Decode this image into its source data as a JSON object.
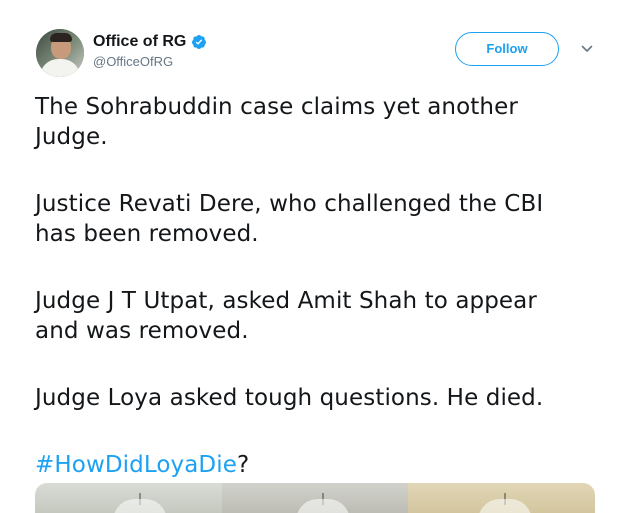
{
  "author": {
    "display_name": "Office of RG",
    "handle": "@OfficeOfRG",
    "verified": true,
    "avatar_icon": "profile-photo"
  },
  "actions": {
    "follow_label": "Follow",
    "more_icon": "chevron-down-icon"
  },
  "tweet": {
    "paragraphs": [
      [
        "The Sohrabuddin case claims yet another",
        "Judge."
      ],
      [
        "Justice Revati Dere, who challenged the CBI",
        "has been removed."
      ],
      [
        "Judge J T Utpat, asked Amit Shah to appear",
        "and was removed."
      ],
      [
        "Judge Loya asked tough questions. He died."
      ]
    ],
    "hashtag": "#HowDidLoyaDie",
    "hashtag_suffix": "?"
  },
  "colors": {
    "accent": "#1da1f2",
    "text": "#14171a",
    "secondary": "#657786"
  }
}
